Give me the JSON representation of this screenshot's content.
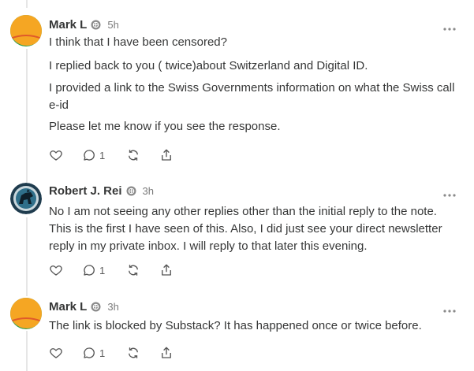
{
  "comments": [
    {
      "author": "Mark L",
      "time": "5h",
      "paragraphs": [
        "I think that I have been censored?",
        "I replied back to you ( twice)about Switzerland and Digital ID.",
        "I provided a link to the Swiss Governments information on what the Swiss call e-id",
        "Please let me know if you see the response."
      ],
      "reply_count": "1"
    },
    {
      "author": "Robert J. Rei",
      "time": "3h",
      "paragraphs": [
        "No I am not seeing any other replies other than the initial reply to the note. This is the first I have seen of this. Also, I did just see your direct newsletter reply in my private inbox. I will reply to that later this evening."
      ],
      "reply_count": "1"
    },
    {
      "author": "Mark L",
      "time": "3h",
      "paragraphs": [
        "The link is blocked by Substack? It has happened once or twice before."
      ],
      "reply_count": "1"
    }
  ],
  "colors": {
    "text": "#363737",
    "muted": "#7a7a7a",
    "thread_line": "#e6e6e6",
    "avatar_orange": "#f5a623",
    "avatar_green": "#2e9e4f"
  },
  "icons": [
    "heart-icon",
    "comment-icon",
    "restack-icon",
    "share-icon",
    "more-icon",
    "subscriber-badge-icon"
  ]
}
